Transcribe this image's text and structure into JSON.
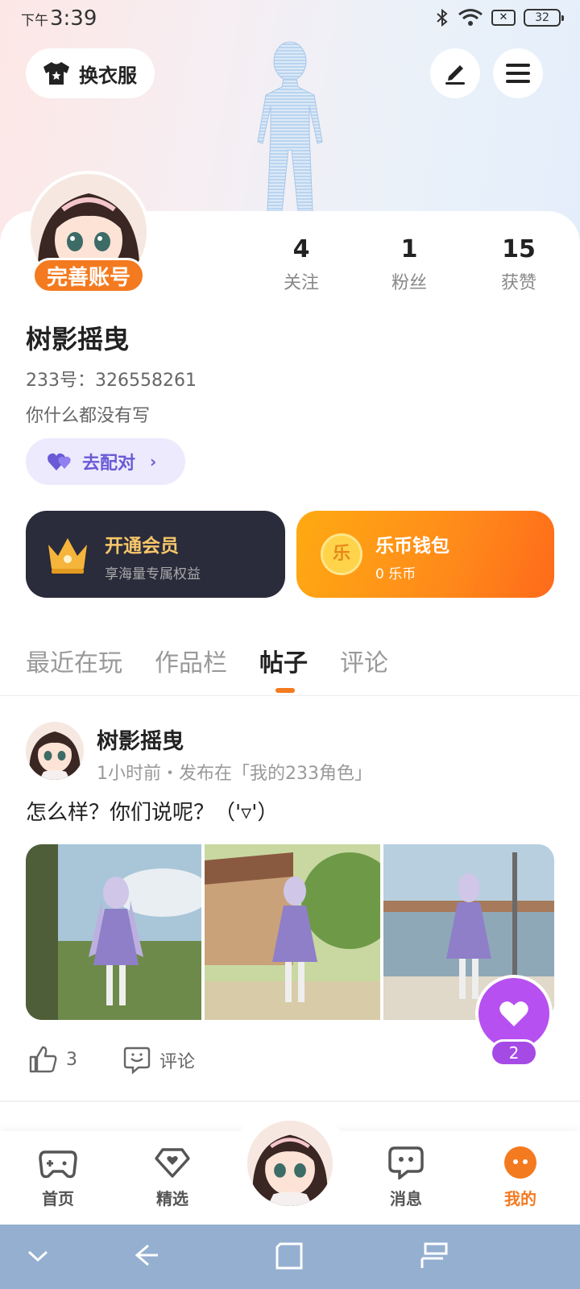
{
  "status_bar": {
    "period": "下午",
    "time": "3:39",
    "battery": "32"
  },
  "header": {
    "outfit_label": "换衣服"
  },
  "profile": {
    "complete_label": "完善账号",
    "stats": [
      {
        "value": "4",
        "label": "关注"
      },
      {
        "value": "1",
        "label": "粉丝"
      },
      {
        "value": "15",
        "label": "获赞"
      }
    ],
    "name": "树影摇曳",
    "id_text": "233号：326558261",
    "bio": "你什么都没有写",
    "match_label": "去配对"
  },
  "promo": {
    "vip_title": "开通会员",
    "vip_sub": "享海量专属权益",
    "wallet_title": "乐币钱包",
    "wallet_sub": "0 乐币",
    "coin_char": "乐"
  },
  "tabs": [
    {
      "label": "最近在玩"
    },
    {
      "label": "作品栏"
    },
    {
      "label": "帖子"
    },
    {
      "label": "评论"
    }
  ],
  "post": {
    "author": "树影摇曳",
    "meta": "1小时前・发布在「我的233角色」",
    "text": "怎么样？你们说呢？（'▿'）",
    "likes": "3",
    "comment_label": "评论"
  },
  "fab": {
    "count": "2"
  },
  "bottom_nav": [
    {
      "label": "首页"
    },
    {
      "label": "精选"
    },
    {
      "label": "消息"
    },
    {
      "label": "我的"
    }
  ],
  "colors": {
    "accent": "#f47a1f",
    "purple": "#b650f0",
    "vip_bg": "#2a2b3b",
    "system_bar": "#94afd0"
  }
}
